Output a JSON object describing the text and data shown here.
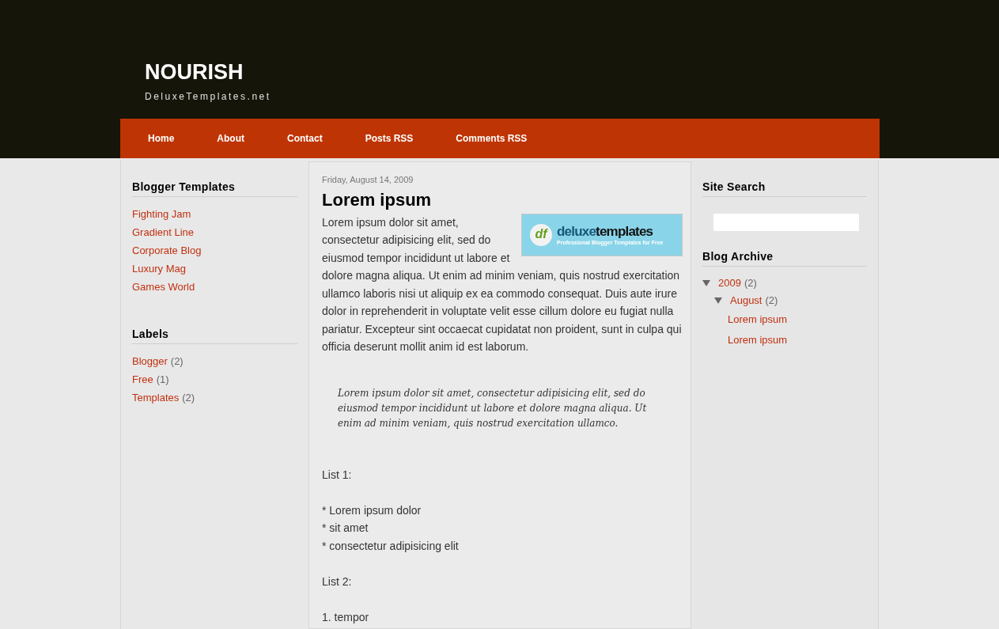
{
  "header": {
    "title": "NOURISH",
    "tagline": "DeluxeTemplates.net"
  },
  "nav": [
    "Home",
    "About",
    "Contact",
    "Posts RSS",
    "Comments RSS"
  ],
  "left_sidebar": [
    {
      "title": "Blogger Templates",
      "kind": "links",
      "items": [
        {
          "label": "Fighting Jam"
        },
        {
          "label": "Gradient Line"
        },
        {
          "label": "Corporate Blog"
        },
        {
          "label": "Luxury Mag"
        },
        {
          "label": "Games World"
        }
      ]
    },
    {
      "title": "Labels",
      "kind": "labels",
      "items": [
        {
          "label": "Blogger",
          "count": "(2)"
        },
        {
          "label": "Free",
          "count": "(1)"
        },
        {
          "label": "Templates",
          "count": "(2)"
        }
      ]
    }
  ],
  "post": {
    "date": "Friday, August 14, 2009",
    "title": "Lorem ipsum",
    "banner": {
      "mark": "df",
      "name_1": "deluxe",
      "name_2": "templates",
      "slogan": "Professional Blogger Templates for Free"
    },
    "body_beside_banner": "Lorem ipsum dolor sit amet, consectetur adipisicing elit, sed do eiusmod tempor incididunt ut labore et",
    "body": "dolore magna aliqua. Ut enim ad minim veniam, quis nostrud exercitation ullamco laboris nisi ut aliquip ex ea commodo consequat. Duis aute irure dolor in reprehenderit in voluptate velit esse cillum dolore eu fugiat nulla pariatur. Excepteur sint occaecat cupidatat non proident, sunt in culpa qui officia deserunt mollit anim id est laborum.",
    "quote": "Lorem ipsum dolor sit amet, consectetur adipisicing elit, sed do eiusmod tempor incididunt ut labore et dolore magna aliqua. Ut enim ad minim veniam, quis nostrud exercitation ullamco.",
    "lines": [
      {
        "kind": "gap"
      },
      {
        "kind": "text",
        "text": "List 1:"
      },
      {
        "kind": "blank"
      },
      {
        "kind": "text",
        "text": "* Lorem ipsum dolor"
      },
      {
        "kind": "text",
        "text": "* sit amet"
      },
      {
        "kind": "text",
        "text": "* consectetur adipisicing elit"
      },
      {
        "kind": "blank"
      },
      {
        "kind": "text",
        "text": "List 2:"
      },
      {
        "kind": "blank"
      },
      {
        "kind": "text",
        "text": "1. tempor"
      }
    ]
  },
  "right_sidebar": {
    "search_title": "Site Search",
    "archive_title": "Blog Archive",
    "archive": [
      {
        "label": "2009",
        "count": "(2)",
        "expanded": true,
        "children": [
          {
            "label": "August",
            "count": "(2)",
            "expanded": true,
            "children": [
              {
                "label": "Lorem ipsum"
              },
              {
                "label": "Lorem ipsum"
              }
            ]
          }
        ]
      }
    ]
  }
}
